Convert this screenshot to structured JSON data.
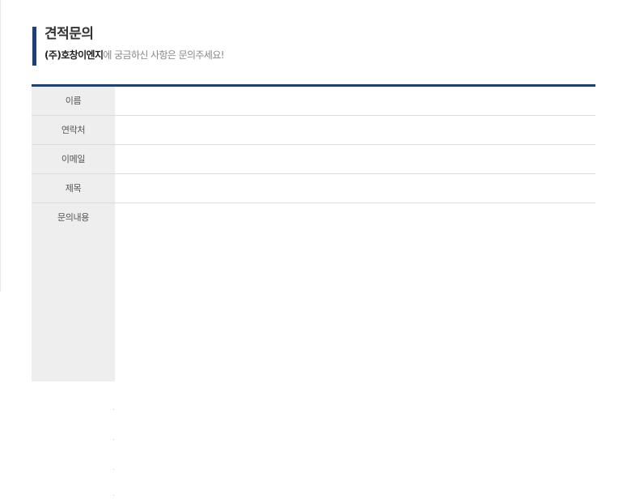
{
  "header": {
    "title": "견적문의",
    "company": "(주)호창이엔지",
    "subtitle_rest": "에 궁금하신 사항은 문의주세요!"
  },
  "form": {
    "fields": [
      {
        "label": "이름",
        "value": ""
      },
      {
        "label": "연락처",
        "value": ""
      },
      {
        "label": "이메일",
        "value": ""
      },
      {
        "label": "제목",
        "value": ""
      }
    ],
    "message_label": "문의내용",
    "message_value": ""
  }
}
